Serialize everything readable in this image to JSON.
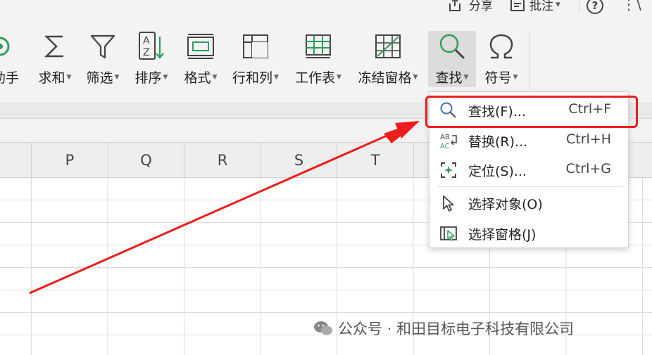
{
  "topbar": {
    "share_label": "分享",
    "review_label": "批注",
    "help_label": "?",
    "more_label": "⋮",
    "minimize_label": "\\"
  },
  "ribbon": {
    "items": [
      {
        "label": "助手",
        "icon": "assistant-icon",
        "caret": false
      },
      {
        "label": "求和",
        "icon": "sigma-icon",
        "caret": true
      },
      {
        "label": "筛选",
        "icon": "filter-icon",
        "caret": true
      },
      {
        "label": "排序",
        "icon": "sort-az-icon",
        "caret": true
      },
      {
        "label": "格式",
        "icon": "format-icon",
        "caret": true
      },
      {
        "label": "行和列",
        "icon": "rows-columns-icon",
        "caret": true
      },
      {
        "label": "工作表",
        "icon": "worksheet-icon",
        "caret": true
      },
      {
        "label": "冻结窗格",
        "icon": "freeze-panes-icon",
        "caret": true
      },
      {
        "label": "查找",
        "icon": "search-icon",
        "caret": true
      },
      {
        "label": "符号",
        "icon": "omega-icon",
        "caret": true
      }
    ]
  },
  "columns": [
    "P",
    "Q",
    "R",
    "S",
    "T"
  ],
  "find_menu": {
    "items": [
      {
        "label": "查找(F)...",
        "shortcut": "Ctrl+F",
        "icon": "search-icon"
      },
      {
        "label": "替换(R)...",
        "shortcut": "Ctrl+H",
        "icon": "replace-icon"
      },
      {
        "label": "定位(S)...",
        "shortcut": "Ctrl+G",
        "icon": "locate-icon"
      },
      {
        "label": "选择对象(O)",
        "shortcut": "",
        "icon": "cursor-icon"
      },
      {
        "label": "选择窗格(J)",
        "shortcut": "",
        "icon": "selection-pane-icon"
      }
    ]
  },
  "watermark": {
    "text": "公众号 · 和田目标电子科技有限公司"
  },
  "colors": {
    "highlight": "#ee1c1c",
    "accent_green": "#2e9e5b",
    "ribbon_bg": "#f3f3f3"
  }
}
